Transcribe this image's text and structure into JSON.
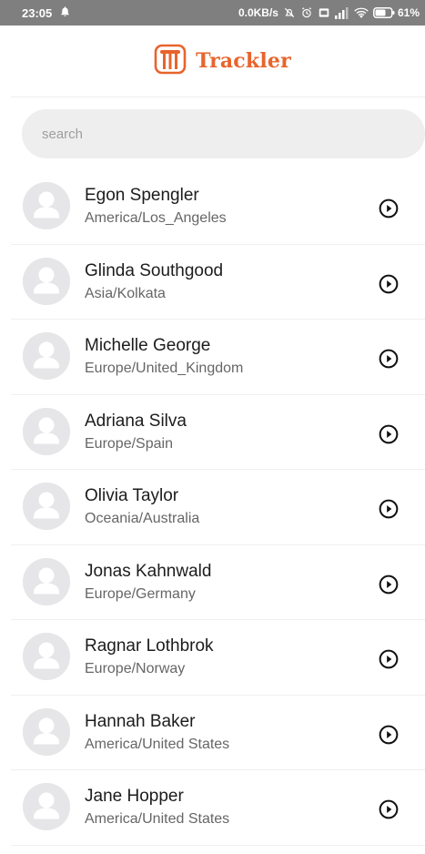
{
  "status_bar": {
    "time": "23:05",
    "net_speed": "0.0KB/s",
    "battery": "61%"
  },
  "header": {
    "app_name": "Trackler",
    "logo_icon": "trackler-logo-icon",
    "accent_color": "#e8642c"
  },
  "search": {
    "placeholder": "search",
    "value": ""
  },
  "contacts": [
    {
      "name": "Egon Spengler",
      "timezone": "America/Los_Angeles"
    },
    {
      "name": "Glinda Southgood",
      "timezone": "Asia/Kolkata"
    },
    {
      "name": "Michelle George",
      "timezone": "Europe/United_Kingdom"
    },
    {
      "name": "Adriana Silva",
      "timezone": "Europe/Spain"
    },
    {
      "name": "Olivia Taylor",
      "timezone": "Oceania/Australia"
    },
    {
      "name": "Jonas Kahnwald",
      "timezone": "Europe/Germany"
    },
    {
      "name": "Ragnar Lothbrok",
      "timezone": "Europe/Norway"
    },
    {
      "name": "Hannah Baker",
      "timezone": "America/United States"
    },
    {
      "name": "Jane Hopper",
      "timezone": "America/United States"
    }
  ],
  "icons": {
    "avatar": "person-placeholder-icon",
    "row_action": "play-circle-icon"
  }
}
